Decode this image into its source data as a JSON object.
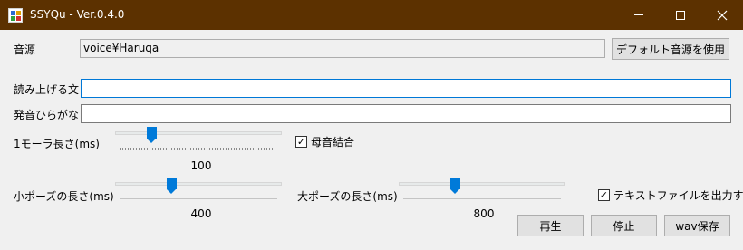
{
  "window": {
    "title": "SSYQu - Ver.0.4.0",
    "controls": {
      "minimize": "—",
      "maximize": "□",
      "close": "✕"
    }
  },
  "source": {
    "label": "音源",
    "value": "voice¥Haruqa",
    "default_button": "デフォルト音源を使用"
  },
  "read_text": {
    "label": "読み上げる文",
    "value": ""
  },
  "hiragana": {
    "label": "発音ひらがな",
    "value": ""
  },
  "mora": {
    "label": "1モーラ長さ(ms)",
    "value": "100",
    "level": 0.2
  },
  "vowel_join": {
    "label": "母音結合",
    "checked": "✓"
  },
  "small_pause": {
    "label": "小ポーズの長さ(ms)",
    "value": "400",
    "level": 0.33
  },
  "large_pause": {
    "label": "大ポーズの長さ(ms)",
    "value": "800",
    "level": 0.33
  },
  "text_output": {
    "label": "テキストファイルを出力する",
    "checked": "✓"
  },
  "buttons": {
    "play": "再生",
    "stop": "停止",
    "save_wav": "wav保存"
  },
  "colors": {
    "titlebar": "#5c3100",
    "thumb": "#007ad9",
    "focus": "#0078d7"
  }
}
